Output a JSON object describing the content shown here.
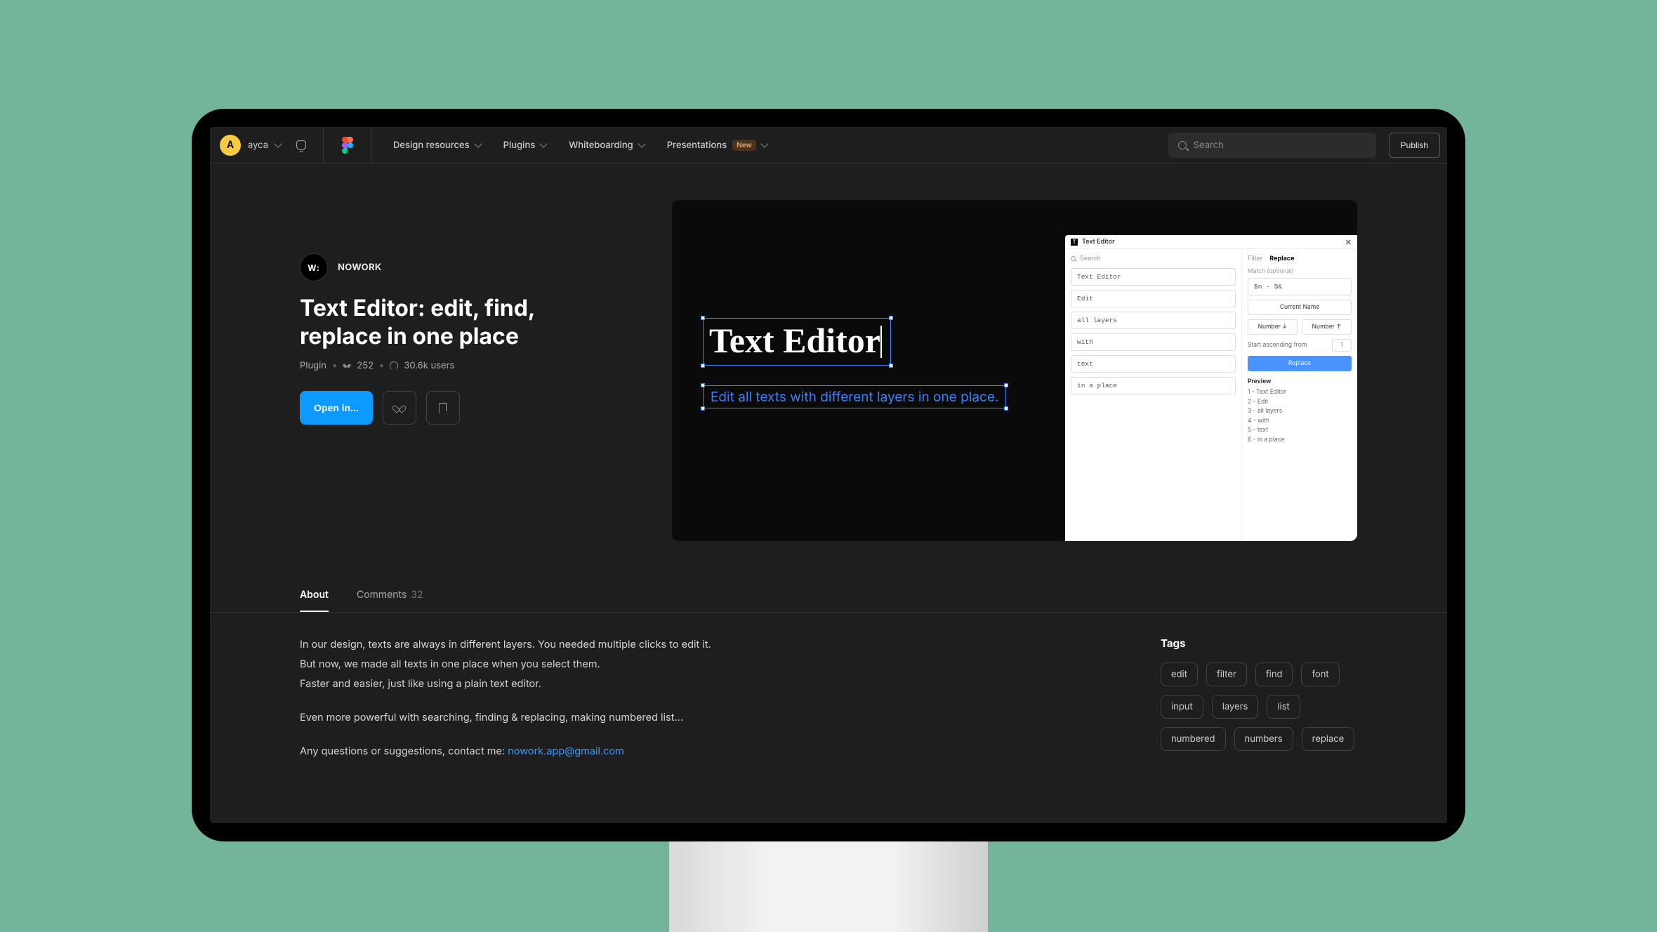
{
  "nav": {
    "avatar_letter": "A",
    "username": "ayca",
    "links": {
      "design": "Design resources",
      "plugins": "Plugins",
      "whiteboarding": "Whiteboarding",
      "presentations": "Presentations",
      "new_badge": "New"
    },
    "search_placeholder": "Search",
    "publish": "Publish"
  },
  "listing": {
    "author_name": "NOWORK",
    "author_mark": "W:",
    "title": "Text Editor: edit, find, replace in one place",
    "type": "Plugin",
    "likes": "252",
    "users": "30.6k users",
    "open_label": "Open in..."
  },
  "hero": {
    "heading": "Text Editor",
    "sub": "Edit all texts with different layers in one place."
  },
  "panel": {
    "title": "Text Editor",
    "search_ph": "Search",
    "fields": [
      "Text Editor",
      "Edit",
      "all layers",
      "with",
      "text",
      "in a place"
    ],
    "tabs": {
      "filter": "Filter",
      "replace": "Replace"
    },
    "match_label": "Match (optional)",
    "match_value": "$n - $&",
    "current_btn": "Current Name",
    "num_down": "Number ↓",
    "num_up": "Number ↑",
    "ascend_label": "Start ascending from",
    "ascend_value": "1",
    "replace_btn": "Replace",
    "preview_title": "Preview",
    "preview": [
      "1 - Text Editor",
      "2 - Edit",
      "3 - all layers",
      "4 - with",
      "5 - text",
      "6 - in a place"
    ]
  },
  "tabs": {
    "about": "About",
    "comments": "Comments",
    "comments_count": "32"
  },
  "desc": {
    "p1": "In our design, texts are always in different layers. You needed multiple clicks to edit it.",
    "p2": "But now, we made all texts in one place when you select them.",
    "p3": "Faster and easier, just like using a plain text editor.",
    "p4": "Even more powerful with searching, finding & replacing, making numbered list…",
    "p5_prefix": "Any questions or suggestions, contact me: ",
    "p5_link": "nowork.app@gmail.com"
  },
  "side": {
    "heading": "Tags",
    "tags": [
      "edit",
      "filter",
      "find",
      "font",
      "input",
      "layers",
      "list",
      "numbered",
      "numbers",
      "replace"
    ]
  }
}
